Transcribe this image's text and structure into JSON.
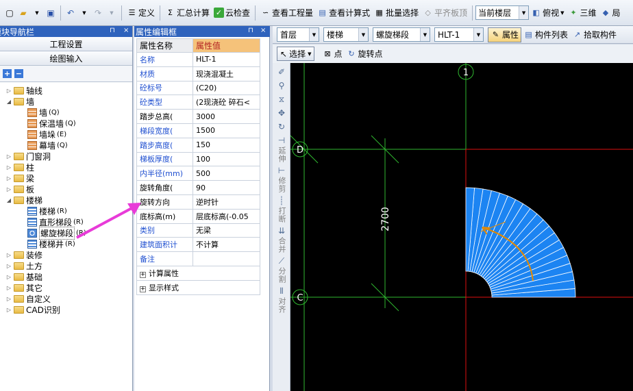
{
  "toolbar": {
    "buttons": [
      {
        "name": "new-icon"
      },
      {
        "name": "open-icon"
      },
      {
        "name": "save-icon"
      },
      {
        "name": "undo-icon"
      },
      {
        "name": "redo-icon"
      }
    ],
    "define": "定义",
    "sum_calc": "汇总计算",
    "cloud_check": "云检查",
    "view_quantity": "查看工程量",
    "view_formula": "查看计算式",
    "batch_select": "批量选择",
    "level_top": "平齐板顶",
    "floor_select": "当前楼层",
    "top_view": "俯视",
    "three_d": "三维",
    "truncated": "局"
  },
  "nav_panel": {
    "title": "模块导航栏",
    "btn_project_settings": "工程设置",
    "btn_drawing_input": "绘图输入",
    "tree": [
      {
        "label": "轴线",
        "level": 0,
        "expanded": false
      },
      {
        "label": "墙",
        "level": 0,
        "expanded": true
      },
      {
        "label": "墙",
        "key": "(Q)",
        "level": 1,
        "icon": "brick"
      },
      {
        "label": "保温墙",
        "key": "(Q)",
        "level": 1,
        "icon": "brick"
      },
      {
        "label": "墙垛",
        "key": "(E)",
        "level": 1,
        "icon": "brick"
      },
      {
        "label": "幕墙",
        "key": "(Q)",
        "level": 1,
        "icon": "brick"
      },
      {
        "label": "门窗洞",
        "level": 0,
        "expanded": false
      },
      {
        "label": "柱",
        "level": 0,
        "expanded": false
      },
      {
        "label": "梁",
        "level": 0,
        "expanded": false
      },
      {
        "label": "板",
        "level": 0,
        "expanded": false
      },
      {
        "label": "楼梯",
        "level": 0,
        "expanded": true
      },
      {
        "label": "楼梯",
        "key": "(R)",
        "level": 1,
        "icon": "stair"
      },
      {
        "label": "直形梯段",
        "key": "(R)",
        "level": 1,
        "icon": "stair"
      },
      {
        "label": "螺旋梯段",
        "key": "(R)",
        "level": 1,
        "icon": "spiral",
        "selected": true
      },
      {
        "label": "楼梯井",
        "key": "(R)",
        "level": 1,
        "icon": "stair"
      },
      {
        "label": "装修",
        "level": 0,
        "expanded": false
      },
      {
        "label": "土方",
        "level": 0,
        "expanded": false
      },
      {
        "label": "基础",
        "level": 0,
        "expanded": false
      },
      {
        "label": "其它",
        "level": 0,
        "expanded": false
      },
      {
        "label": "自定义",
        "level": 0,
        "expanded": false
      },
      {
        "label": "CAD识别",
        "level": 0,
        "expanded": false
      }
    ]
  },
  "prop_panel": {
    "title": "属性编辑框",
    "col_name": "属性名称",
    "col_value": "属性值",
    "rows": [
      {
        "k": "名称",
        "v": "HLT-1",
        "blue": true
      },
      {
        "k": "材质",
        "v": "现浇混凝土",
        "blue": true
      },
      {
        "k": "砼标号",
        "v": "(C20)",
        "blue": true
      },
      {
        "k": "砼类型",
        "v": "(2现浇砼 碎石<",
        "blue": true
      },
      {
        "k": "踏步总高(",
        "v": "3000",
        "blue": false
      },
      {
        "k": "梯段宽度(",
        "v": "1500",
        "blue": true
      },
      {
        "k": "踏步高度(",
        "v": "150",
        "blue": true
      },
      {
        "k": "梯板厚度(",
        "v": "100",
        "blue": true
      },
      {
        "k": "内半径(mm)",
        "v": "500",
        "blue": true
      },
      {
        "k": "旋转角度(",
        "v": "90",
        "blue": false
      },
      {
        "k": "旋转方向",
        "v": "逆时针",
        "blue": false
      },
      {
        "k": "底标高(m)",
        "v": "层底标高(-0.05",
        "blue": false
      },
      {
        "k": "类别",
        "v": "无梁",
        "blue": true
      },
      {
        "k": "建筑面积计",
        "v": "不计算",
        "blue": true
      },
      {
        "k": "备注",
        "v": "",
        "blue": true
      }
    ],
    "group_calc": "计算属性",
    "group_display": "显示样式"
  },
  "floor_bar": {
    "floor": "首层",
    "category": "楼梯",
    "type": "螺旋梯段",
    "element": "HLT-1",
    "attr_btn": "属性",
    "list_btn": "构件列表",
    "pick_btn": "拾取构件"
  },
  "select_bar": {
    "select": "选择",
    "point": "点",
    "rotate_point": "旋转点"
  },
  "vertical_tools": {
    "extend": "延伸",
    "trim": "修剪",
    "break": "打断",
    "merge": "合并",
    "split": "分割",
    "align": "对齐"
  },
  "canvas": {
    "axis_1": "1",
    "axis_D": "D",
    "axis_C": "C",
    "dimension": "2700",
    "colors": {
      "background": "#000000",
      "grid": "#2fb82f",
      "axis_red": "#e01010",
      "stair_fill": "#1c84f2",
      "arrow": "#e58a00",
      "pointer_arrow": "#e83bd8"
    }
  }
}
